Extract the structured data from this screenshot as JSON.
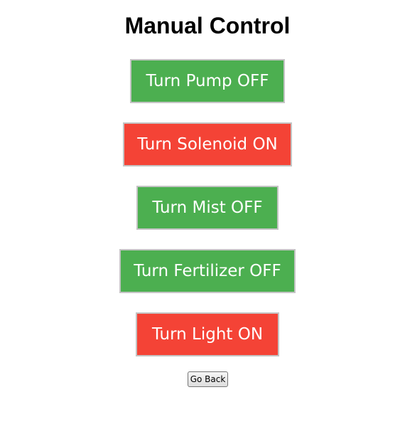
{
  "page": {
    "title": "Manual Control"
  },
  "controls": [
    {
      "label": "Turn Pump OFF",
      "state_color": "#4caf50"
    },
    {
      "label": "Turn Solenoid ON",
      "state_color": "#f44336"
    },
    {
      "label": "Turn Mist OFF",
      "state_color": "#4caf50"
    },
    {
      "label": "Turn Fertilizer OFF",
      "state_color": "#4caf50"
    },
    {
      "label": "Turn Light ON",
      "state_color": "#f44336"
    }
  ],
  "nav": {
    "back_label": "Go Back"
  },
  "colors": {
    "on_green": "#4caf50",
    "off_red": "#f44336",
    "button_text": "#ffffff"
  }
}
